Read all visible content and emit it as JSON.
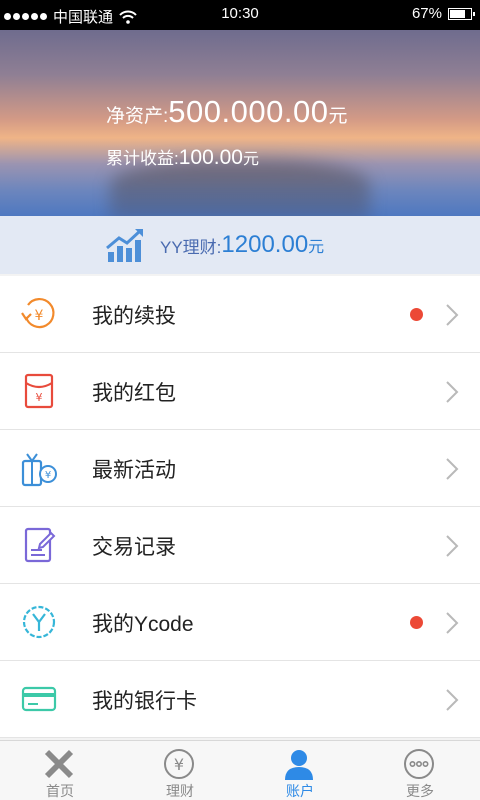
{
  "status_bar": {
    "carrier": "中国联通",
    "time": "10:30",
    "battery": "67%",
    "battery_level": 0.67
  },
  "account": {
    "net_assets_label": "净资产:",
    "net_assets_value": "500.000.00",
    "net_assets_unit": "元",
    "cumulative_income_label": "累计收益:",
    "cumulative_income_value": "100.00",
    "cumulative_income_unit": "元"
  },
  "fund": {
    "label": "YY理财:",
    "value": "1200.00",
    "unit": "元"
  },
  "menu": [
    {
      "label": "我的续投",
      "icon": "renew-yuan-icon",
      "badge": true,
      "color": "#f28a2c"
    },
    {
      "label": "我的红包",
      "icon": "red-envelope-icon",
      "badge": false,
      "color": "#e84b3c"
    },
    {
      "label": "最新活动",
      "icon": "gift-activity-icon",
      "badge": false,
      "color": "#3c8fd8"
    },
    {
      "label": "交易记录",
      "icon": "transaction-record-icon",
      "badge": false,
      "color": "#7a68d8"
    },
    {
      "label": "我的Ycode",
      "icon": "ycode-icon",
      "badge": true,
      "color": "#36b6d8"
    },
    {
      "label": "我的银行卡",
      "icon": "bank-card-icon",
      "badge": false,
      "color": "#3cc9a8"
    }
  ],
  "tabs": [
    {
      "label": "首页",
      "icon": "home-icon",
      "active": false
    },
    {
      "label": "理财",
      "icon": "yuan-icon",
      "active": false
    },
    {
      "label": "账户",
      "icon": "person-icon",
      "active": true
    },
    {
      "label": "更多",
      "icon": "more-icon",
      "active": false
    }
  ],
  "colors": {
    "accent": "#2e8ae6",
    "badge": "#ec4936",
    "tab_inactive": "#8a8a8a"
  }
}
